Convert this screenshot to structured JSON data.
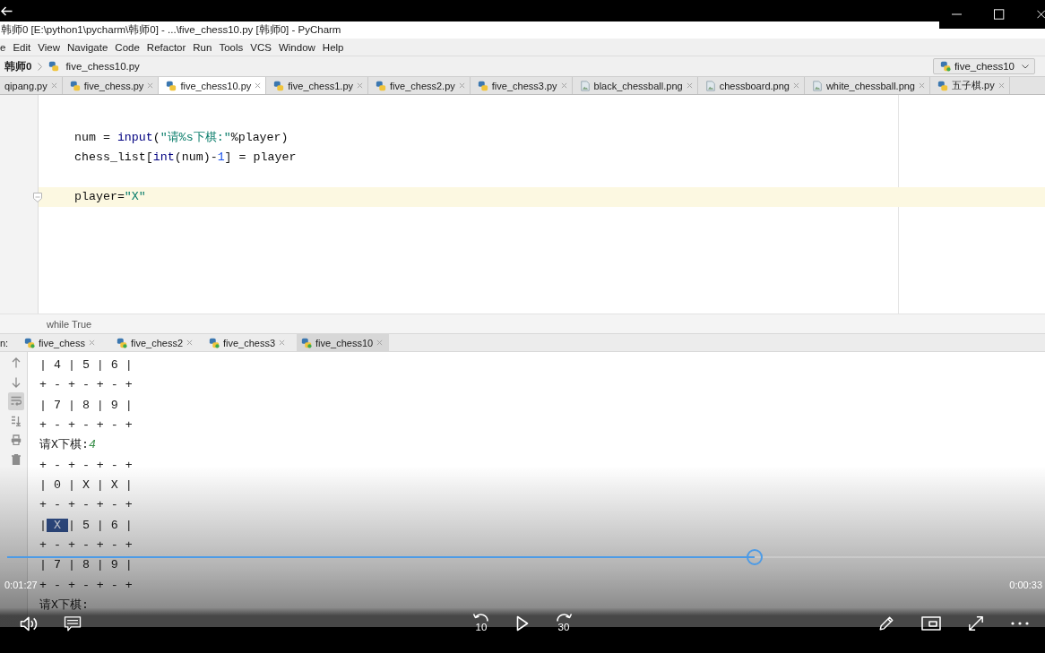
{
  "ide": {
    "title": "韩师0 [E:\\python1\\pycharm\\韩师0] - ...\\five_chess10.py [韩师0] - PyCharm",
    "menu": [
      "e",
      "Edit",
      "View",
      "Navigate",
      "Code",
      "Refactor",
      "Run",
      "Tools",
      "VCS",
      "Window",
      "Help"
    ],
    "breadcrumb": [
      {
        "label": "韩师0",
        "kind": "project"
      },
      {
        "label": "five_chess10.py",
        "kind": "python"
      }
    ],
    "run_config": "five_chess10",
    "editor_tabs": [
      {
        "label": "qipang.py",
        "kind": "label",
        "selected": false
      },
      {
        "label": "five_chess.py",
        "kind": "python",
        "selected": false
      },
      {
        "label": "five_chess10.py",
        "kind": "python",
        "selected": true
      },
      {
        "label": "five_chess1.py",
        "kind": "python",
        "selected": false
      },
      {
        "label": "five_chess2.py",
        "kind": "python",
        "selected": false
      },
      {
        "label": "five_chess3.py",
        "kind": "python",
        "selected": false
      },
      {
        "label": "black_chessball.png",
        "kind": "image",
        "selected": false
      },
      {
        "label": "chessboard.png",
        "kind": "image",
        "selected": false
      },
      {
        "label": "white_chessball.png",
        "kind": "image",
        "selected": false
      },
      {
        "label": "五子棋.py",
        "kind": "python",
        "selected": false
      }
    ],
    "code": {
      "blocks": [
        [
          {
            "current": false,
            "fold_marker": false,
            "tokens": [
              {
                "kind": "plain",
                "text": "num = "
              },
              {
                "kind": "builtin",
                "text": "input"
              },
              {
                "kind": "plain",
                "text": "("
              },
              {
                "kind": "string",
                "text": "\"请%s下棋:\""
              },
              {
                "kind": "plain",
                "text": "%player)"
              }
            ]
          },
          {
            "current": false,
            "fold_marker": false,
            "tokens": [
              {
                "kind": "plain",
                "text": "chess_list["
              },
              {
                "kind": "builtin",
                "text": "int"
              },
              {
                "kind": "plain",
                "text": "(num)-"
              },
              {
                "kind": "number",
                "text": "1"
              },
              {
                "kind": "plain",
                "text": "] = player"
              }
            ]
          }
        ],
        [
          {
            "current": true,
            "fold_marker": true,
            "tokens": [
              {
                "kind": "plain",
                "text": "player="
              },
              {
                "kind": "string",
                "text": "\"X\""
              }
            ]
          }
        ]
      ]
    },
    "code_breadcrumb": "while True",
    "run_label": "n:",
    "run_tabs": [
      {
        "label": "five_chess",
        "selected": false
      },
      {
        "label": "five_chess2",
        "selected": false
      },
      {
        "label": "five_chess3",
        "selected": false
      },
      {
        "label": "five_chess10",
        "selected": true
      }
    ],
    "console": {
      "soft_wrap": true,
      "lines": [
        [
          {
            "kind": "output",
            "text": "| 4 | 5 | 6 |"
          }
        ],
        [
          {
            "kind": "output",
            "text": "+ - + - + - +"
          }
        ],
        [
          {
            "kind": "output",
            "text": "| 7 | 8 | 9 |"
          }
        ],
        [
          {
            "kind": "output",
            "text": "+ - + - + - +"
          }
        ],
        [
          {
            "kind": "output",
            "text": "请X下棋:"
          },
          {
            "kind": "input",
            "text": "4"
          }
        ],
        [
          {
            "kind": "output",
            "text": "+ - + - + - +"
          }
        ],
        [
          {
            "kind": "output",
            "text": "| 0 | X | X |"
          }
        ],
        [
          {
            "kind": "output",
            "text": "+ - + - + - +"
          }
        ],
        [
          {
            "kind": "output",
            "text": "|"
          },
          {
            "kind": "selection",
            "text": " X "
          },
          {
            "kind": "output",
            "text": "| 5 | 6 |"
          }
        ],
        [
          {
            "kind": "output",
            "text": "+ - + - + - +"
          }
        ],
        [
          {
            "kind": "output",
            "text": "| 7 | 8 | 9 |"
          }
        ],
        [
          {
            "kind": "output",
            "text": "+ - + - + - +"
          }
        ],
        [
          {
            "kind": "output",
            "text": "请X下棋:"
          }
        ]
      ]
    }
  },
  "player": {
    "elapsed": "0:01:27",
    "remaining": "0:00:33",
    "progress": {
      "level": 0.72
    },
    "skip_back": "10",
    "skip_forward": "30"
  }
}
